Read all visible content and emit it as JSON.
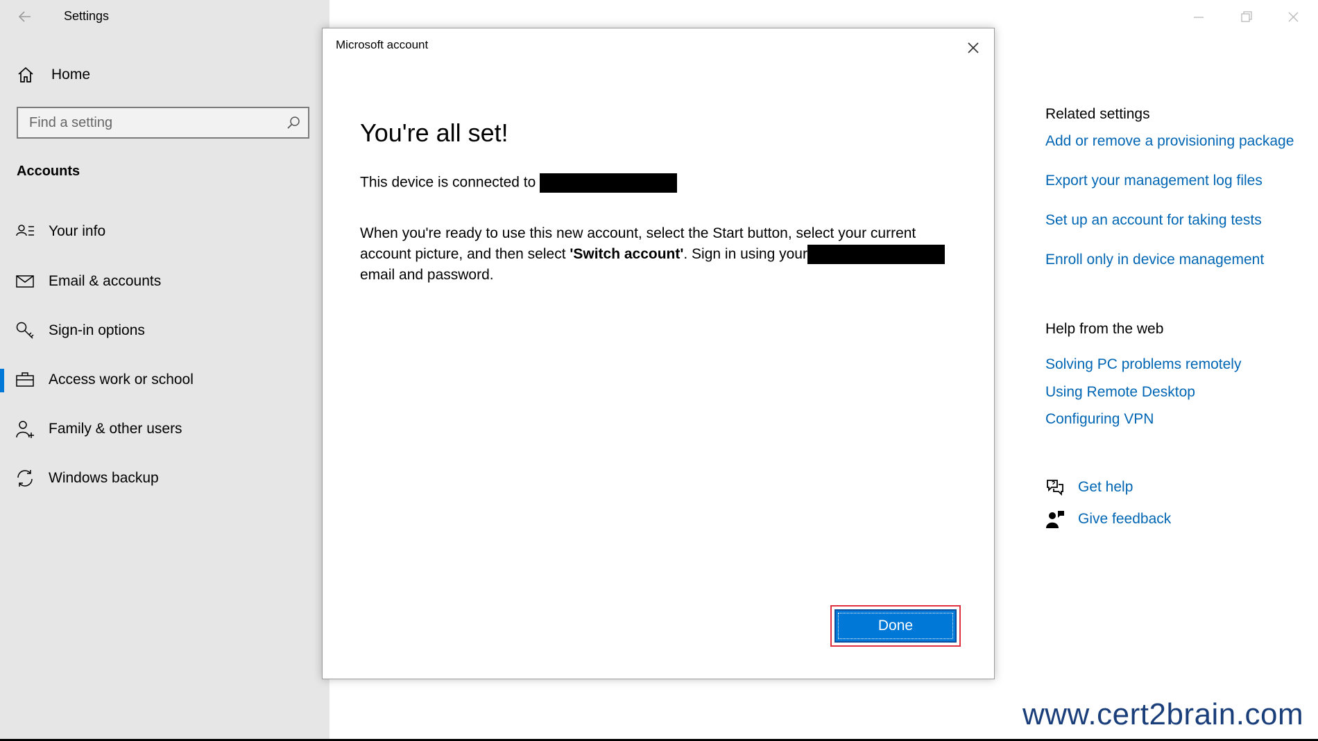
{
  "app": {
    "title": "Settings"
  },
  "sidebar": {
    "home_label": "Home",
    "search_placeholder": "Find a setting",
    "section_title": "Accounts",
    "items": [
      {
        "label": "Your info",
        "icon": "your-info-icon"
      },
      {
        "label": "Email & accounts",
        "icon": "mail-icon"
      },
      {
        "label": "Sign-in options",
        "icon": "key-icon"
      },
      {
        "label": "Access work or school",
        "icon": "briefcase-icon",
        "active": true
      },
      {
        "label": "Family & other users",
        "icon": "add-person-icon"
      },
      {
        "label": "Windows backup",
        "icon": "sync-icon"
      }
    ]
  },
  "dialog": {
    "title": "Microsoft account",
    "heading": "You're all set!",
    "connected_text": "This device is connected to",
    "para_part1": "When you're ready to use this new account, select the Start button, select your current account picture, and then select ",
    "para_bold": "'Switch account'",
    "para_part2": ". Sign in using your",
    "para_part3": "email and password.",
    "done_label": "Done"
  },
  "related": {
    "heading": "Related settings",
    "links": [
      "Add or remove a provisioning package",
      "Export your management log files",
      "Set up an account for taking tests",
      "Enroll only in device management"
    ]
  },
  "help": {
    "heading": "Help from the web",
    "links": [
      "Solving PC problems remotely",
      "Using Remote Desktop",
      "Configuring VPN"
    ]
  },
  "support": {
    "get_help": "Get help",
    "give_feedback": "Give feedback"
  },
  "watermark": "www.cert2brain.com",
  "colors": {
    "accent": "#0078d7",
    "link": "#0066b4",
    "sidebar_bg": "#e6e6e6",
    "highlight_border": "#e03040"
  }
}
